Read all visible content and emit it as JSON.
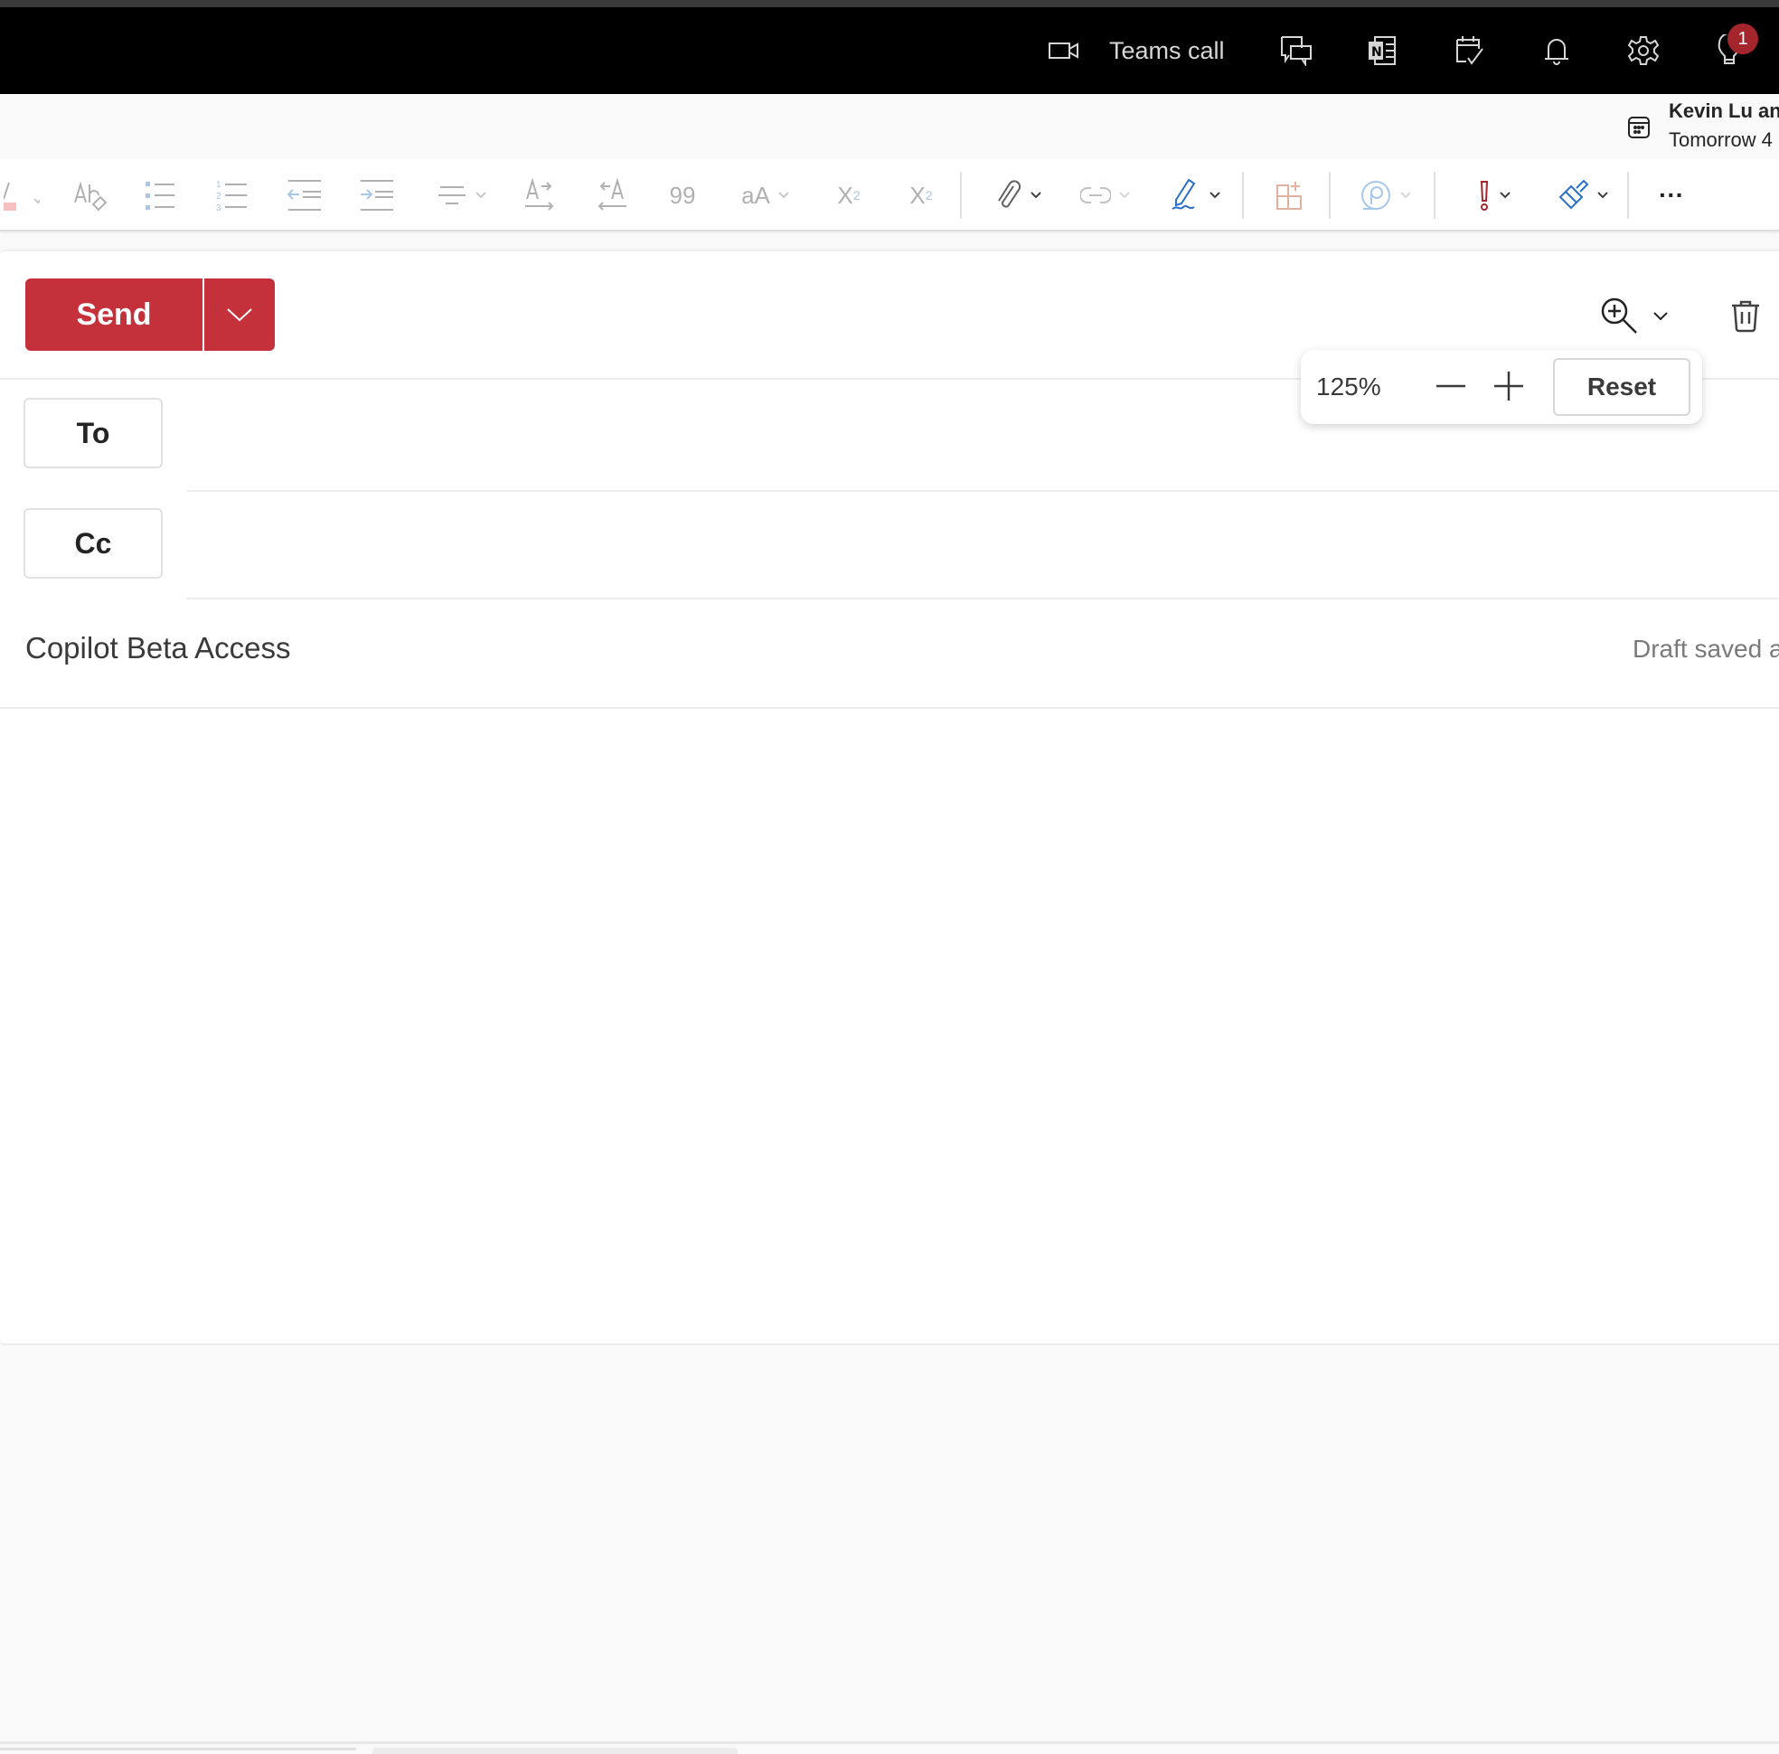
{
  "topbar": {
    "teams_call_label": "Teams call",
    "icons": [
      "video-camera-icon",
      "chat-feedback-icon",
      "onenote-icon",
      "todo-calendar-icon",
      "bell-icon",
      "gear-icon",
      "lightbulb-icon"
    ],
    "tips_badge": "1"
  },
  "reminder": {
    "title": "Kevin Lu an",
    "subtitle": "Tomorrow 4"
  },
  "ribbon": {
    "items": [
      "font-color",
      "clear-formatting",
      "bullets",
      "numbering",
      "decrease-indent",
      "increase-indent",
      "align",
      "ltr",
      "rtl",
      "quote",
      "change-case",
      "subscript",
      "superscript",
      "attach",
      "link",
      "signature",
      "apps",
      "loop",
      "importance",
      "format-painter",
      "more-options"
    ],
    "quote_glyph": "99",
    "case_glyph": "aA",
    "subscript_glyph": "X",
    "superscript_glyph": "X",
    "more_glyph": "···",
    "colors": {
      "importance": "#a4262c",
      "accent_blue": "#2b6fc9",
      "apps": "#e0b3a0"
    }
  },
  "compose": {
    "send_label": "Send",
    "to_label": "To",
    "cc_label": "Cc",
    "to_value": "",
    "cc_value": "",
    "subject": "Copilot Beta Access",
    "draft_status": "Draft saved a",
    "body": ""
  },
  "zoom_popup": {
    "level": "125%",
    "reset_label": "Reset"
  },
  "colors": {
    "send": "#c4313a",
    "topbar": "#000000"
  }
}
